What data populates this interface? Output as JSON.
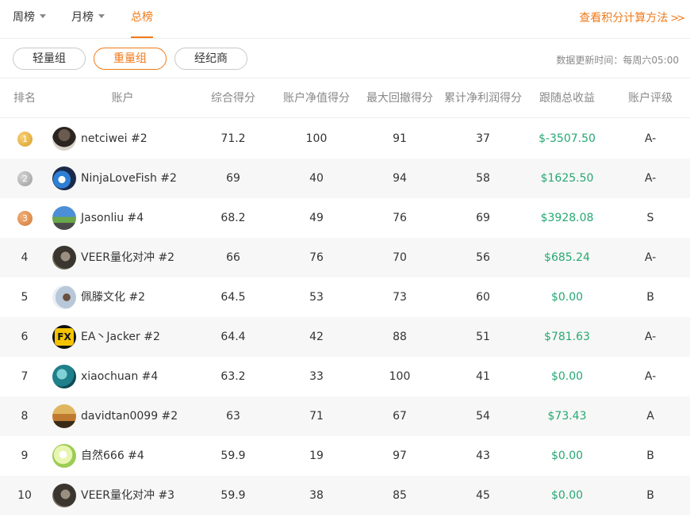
{
  "tabs": {
    "week": "周榜",
    "month": "月榜",
    "total": "总榜"
  },
  "calc_link": "查看积分计算方法",
  "groups": {
    "light": "轻量组",
    "heavy": "重量组",
    "broker": "经纪商"
  },
  "update_time": "数据更新时间：每周六05:00",
  "headers": {
    "rank": "排名",
    "account": "账户",
    "score": "综合得分",
    "nav": "账户净值得分",
    "drawdown": "最大回撤得分",
    "profit": "累计净利润得分",
    "follow_return": "跟随总收益",
    "grade": "账户评级"
  },
  "colors": {
    "accent": "#f07a1a",
    "positive": "#26a873"
  },
  "rows": [
    {
      "rank": "1",
      "medal": "gold",
      "name": "netciwei #2",
      "score": "71.2",
      "nav": "100",
      "drawdown": "91",
      "profit": "37",
      "follow_return": "$-3507.50",
      "grade": "A-"
    },
    {
      "rank": "2",
      "medal": "silver",
      "name": "NinjaLoveFish #2",
      "score": "69",
      "nav": "40",
      "drawdown": "94",
      "profit": "58",
      "follow_return": "$1625.50",
      "grade": "A-"
    },
    {
      "rank": "3",
      "medal": "bronze",
      "name": "Jasonliu #4",
      "score": "68.2",
      "nav": "49",
      "drawdown": "76",
      "profit": "69",
      "follow_return": "$3928.08",
      "grade": "S"
    },
    {
      "rank": "4",
      "name": "VEER量化对冲 #2",
      "score": "66",
      "nav": "76",
      "drawdown": "70",
      "profit": "56",
      "follow_return": "$685.24",
      "grade": "A-"
    },
    {
      "rank": "5",
      "name": "佩滕文化 #2",
      "score": "64.5",
      "nav": "53",
      "drawdown": "73",
      "profit": "60",
      "follow_return": "$0.00",
      "grade": "B"
    },
    {
      "rank": "6",
      "name": "EA丶Jacker #2",
      "score": "64.4",
      "nav": "42",
      "drawdown": "88",
      "profit": "51",
      "follow_return": "$781.63",
      "grade": "A-",
      "avatar_text": "FX"
    },
    {
      "rank": "7",
      "name": "xiaochuan #4",
      "score": "63.2",
      "nav": "33",
      "drawdown": "100",
      "profit": "41",
      "follow_return": "$0.00",
      "grade": "A-"
    },
    {
      "rank": "8",
      "name": "davidtan0099 #2",
      "score": "63",
      "nav": "71",
      "drawdown": "67",
      "profit": "54",
      "follow_return": "$73.43",
      "grade": "A"
    },
    {
      "rank": "9",
      "name": "自然666 #4",
      "score": "59.9",
      "nav": "19",
      "drawdown": "97",
      "profit": "43",
      "follow_return": "$0.00",
      "grade": "B"
    },
    {
      "rank": "10",
      "name": "VEER量化对冲 #3",
      "score": "59.9",
      "nav": "38",
      "drawdown": "85",
      "profit": "45",
      "follow_return": "$0.00",
      "grade": "B"
    }
  ]
}
